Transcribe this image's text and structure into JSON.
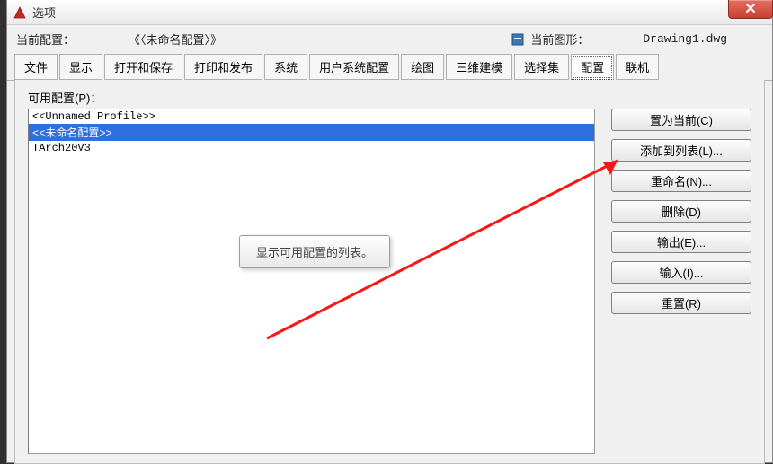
{
  "window": {
    "title": "选项"
  },
  "meta": {
    "current_profile_label": "当前配置：",
    "current_profile_value": "《〈未命名配置〉》",
    "current_drawing_label": "当前图形：",
    "current_drawing_value": "Drawing1.dwg"
  },
  "tabs": [
    {
      "label": "文件"
    },
    {
      "label": "显示"
    },
    {
      "label": "打开和保存"
    },
    {
      "label": "打印和发布"
    },
    {
      "label": "系统"
    },
    {
      "label": "用户系统配置"
    },
    {
      "label": "绘图"
    },
    {
      "label": "三维建模"
    },
    {
      "label": "选择集"
    },
    {
      "label": "配置",
      "active": true
    },
    {
      "label": "联机"
    }
  ],
  "pane": {
    "available_label": "可用配置(P)：",
    "list": [
      {
        "text": "<<Unnamed Profile>>",
        "selected": false
      },
      {
        "text": "<<未命名配置>>",
        "selected": true
      },
      {
        "text": "TArch20V3",
        "selected": false
      }
    ],
    "tooltip": "显示可用配置的列表。",
    "buttons": {
      "set_current": "置为当前(C)",
      "add_to_list": "添加到列表(L)...",
      "rename": "重命名(N)...",
      "delete": "删除(D)",
      "export": "输出(E)...",
      "import": "输入(I)...",
      "reset": "重置(R)"
    }
  },
  "icons": {
    "close": "close-icon",
    "app": "app-icon",
    "dwg": "dwg-icon"
  }
}
